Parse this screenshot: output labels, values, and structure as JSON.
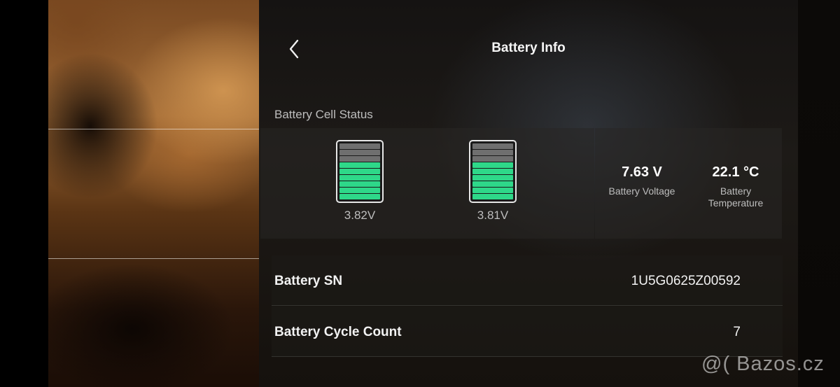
{
  "header": {
    "title": "Battery Info",
    "back_icon": "chevron-left-icon"
  },
  "cell_status": {
    "section_label": "Battery Cell Status",
    "cells": [
      {
        "voltage": "3.82V",
        "level_segments_filled": 6,
        "level_segments_total": 9
      },
      {
        "voltage": "3.81V",
        "level_segments_filled": 6,
        "level_segments_total": 9
      }
    ],
    "fill_color": "#2ed889",
    "empty_color": "#6f6f6f"
  },
  "summary": {
    "voltage_value": "7.63 V",
    "voltage_label": "Battery Voltage",
    "temperature_value": "22.1 °C",
    "temperature_label": "Battery Temperature"
  },
  "details": {
    "sn_label": "Battery SN",
    "sn_value": "1U5G0625Z00592",
    "cycle_label": "Battery Cycle Count",
    "cycle_value": "7"
  },
  "watermark": "@( Bazos.cz"
}
